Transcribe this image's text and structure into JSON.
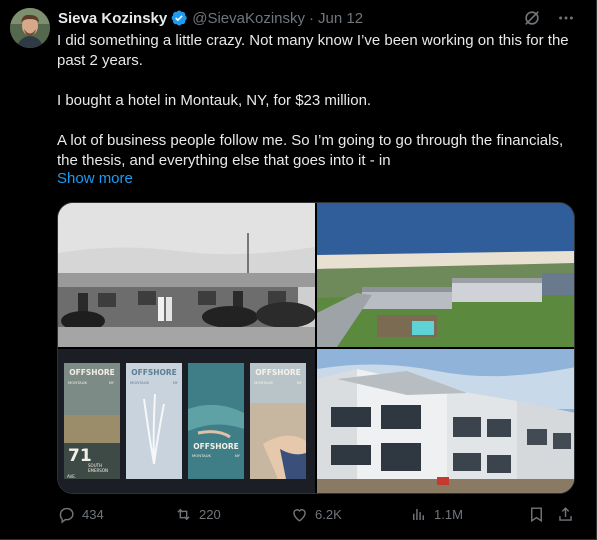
{
  "author": {
    "name": "Sieva Kozinsky",
    "handle": "@SievaKozinsky",
    "date": "Jun 12"
  },
  "tweet": {
    "lines": [
      "I did something a little crazy. Not many know I’ve been working on this for the past 2 years.",
      "I bought a hotel in Montauk, NY, for $23 million.",
      "A lot of business people follow me. So I’m going to go through the financials, the thesis, and everything else that goes into it - in"
    ],
    "show_more": "Show more"
  },
  "media": {
    "poster_brand": "OFFSHORE",
    "poster_city": "MONTAUK",
    "poster_state": "NY",
    "poster_number": "71",
    "poster_street1": "SOUTH",
    "poster_street2": "EMERSON",
    "poster_street3": "AVE."
  },
  "actions": {
    "replies": "434",
    "reposts": "220",
    "likes": "6.2K",
    "views": "1.1M"
  },
  "colors": {
    "accent": "#1d9bf0",
    "muted": "#71767b",
    "text": "#e7e9ea",
    "border": "#2f3336"
  }
}
